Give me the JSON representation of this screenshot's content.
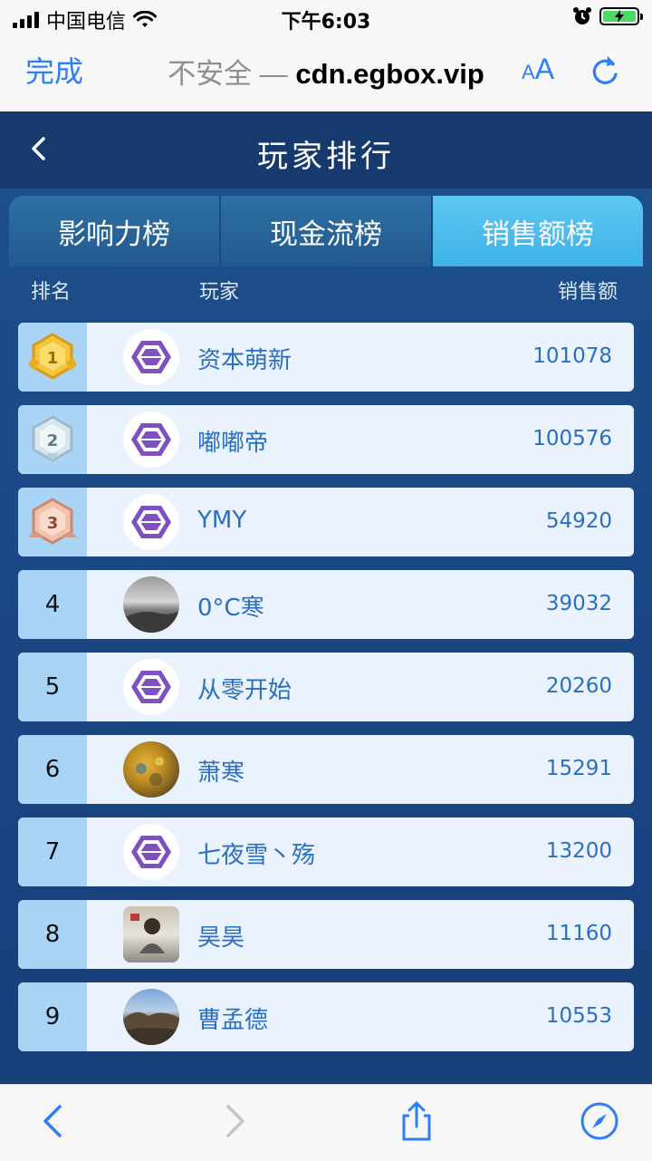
{
  "status_bar": {
    "carrier": "中国电信",
    "time": "下午6:03"
  },
  "safari": {
    "done_label": "完成",
    "insecure_label": "不安全 —",
    "domain": "cdn.egbox.vip",
    "text_size_small": "A",
    "text_size_big": "A"
  },
  "header": {
    "title": "玩家排行"
  },
  "tabs": [
    {
      "label": "影响力榜",
      "active": false
    },
    {
      "label": "现金流榜",
      "active": false
    },
    {
      "label": "销售额榜",
      "active": true
    }
  ],
  "columns": {
    "rank": "排名",
    "player": "玩家",
    "sales": "销售额"
  },
  "rows": [
    {
      "rank": "1",
      "medal": "gold-medal",
      "avatar": "hexagon-avatar",
      "name": "资本萌新",
      "sales": "101078"
    },
    {
      "rank": "2",
      "medal": "silver-medal",
      "avatar": "hexagon-avatar",
      "name": "嘟嘟帝",
      "sales": "100576"
    },
    {
      "rank": "3",
      "medal": "bronze-medal",
      "avatar": "hexagon-avatar",
      "name": "YMY",
      "sales": "54920"
    },
    {
      "rank": "4",
      "medal": "",
      "avatar": "photo-sky-avatar",
      "name": "0°C寒",
      "sales": "39032"
    },
    {
      "rank": "5",
      "medal": "",
      "avatar": "hexagon-avatar",
      "name": "从零开始",
      "sales": "20260"
    },
    {
      "rank": "6",
      "medal": "",
      "avatar": "photo-autumn-avatar",
      "name": "萧寒",
      "sales": "15291"
    },
    {
      "rank": "7",
      "medal": "",
      "avatar": "hexagon-avatar",
      "name": "七夜雪丶殇",
      "sales": "13200"
    },
    {
      "rank": "8",
      "medal": "",
      "avatar": "photo-person-avatar",
      "name": "昊昊",
      "sales": "11160"
    },
    {
      "rank": "9",
      "medal": "",
      "avatar": "photo-landscape-avatar",
      "name": "曹孟德",
      "sales": "10553"
    }
  ],
  "colors": {
    "accent": "#2f7ef6",
    "tab_active": "#4bbcec",
    "value_text": "#2a6fc0"
  }
}
